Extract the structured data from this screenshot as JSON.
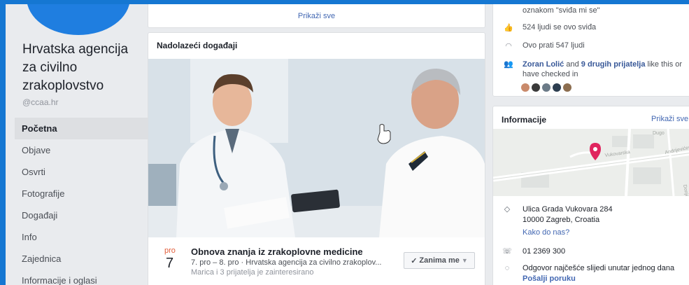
{
  "sidebar": {
    "page_name": "Hrvatska agencija za civilno zrakoplovstvo",
    "handle": "@ccaa.hr",
    "items": [
      {
        "label": "Početna",
        "active": true
      },
      {
        "label": "Objave"
      },
      {
        "label": "Osvrti"
      },
      {
        "label": "Fotografije"
      },
      {
        "label": "Događaji"
      },
      {
        "label": "Info"
      },
      {
        "label": "Zajednica"
      },
      {
        "label": "Informacije i oglasi"
      }
    ]
  },
  "top_card": {
    "show_all": "Prikaži sve"
  },
  "events": {
    "header": "Nadolazeći događaji",
    "event": {
      "month": "pro",
      "day": "7",
      "title": "Obnova znanja iz zrakoplovne medicine",
      "subtitle": "7. pro – 8. pro · Hrvatska agencija za civilno zrakoplov...",
      "friends": "Marica i 3 prijatelja je zainteresirano",
      "interested_label": "Zanima me"
    }
  },
  "community": {
    "likes_line": "oznakom \"sviđa mi se\"",
    "likes_count": "524 ljudi se ovo sviđa",
    "follows": "Ovo prati 547 ljudi",
    "friend_name": "Zoran Lolić",
    "friends_and": "and",
    "friends_others": "9 drugih prijatelja",
    "friends_tail": "like this or",
    "friends_tail2": "have checked in"
  },
  "info": {
    "title": "Informacije",
    "show_all": "Prikaži sve",
    "address_line1": "Ulica Grada Vukovara 284",
    "address_line2": "10000 Zagreb, Croatia",
    "directions": "Kako do nas?",
    "phone": "01 2369 300",
    "response": "Odgovor najčešće slijedi unutar jednog dana",
    "send_message": "Pošalji poruku",
    "map_labels": [
      "Dugo",
      "Vukovarska",
      "Andrijevićeva",
      "Donje S"
    ]
  },
  "colors": {
    "background": "#1577d2",
    "link": "#4267b2",
    "accent": "#e25d3a",
    "pin": "#e0245e"
  }
}
